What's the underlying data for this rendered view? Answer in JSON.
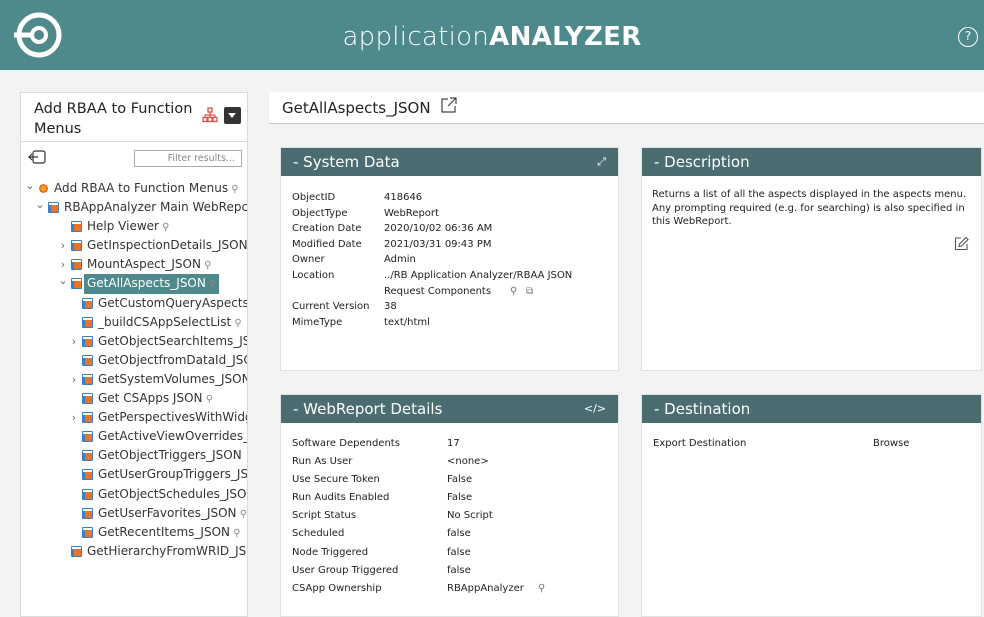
{
  "app": {
    "title_light": "application",
    "title_bold": "ANALYZER",
    "help_icon": "help-icon",
    "help_glyph": "?"
  },
  "left_panel": {
    "title": "Add RBAA to Function Menus",
    "filter_placeholder": "Filter results...",
    "tree": [
      {
        "label": "Add RBAA to Function Menus",
        "level": 0,
        "chevron": "down",
        "icon": "function-menu-icon",
        "pin": true,
        "selected": false
      },
      {
        "label": "RBAppAnalyzer Main WebRepc",
        "level": 1,
        "chevron": "down",
        "icon": "webreport-icon",
        "pin": false,
        "selected": false
      },
      {
        "label": "Help Viewer",
        "level": 2,
        "chevron": "",
        "icon": "webreport-icon",
        "pin": true,
        "selected": false
      },
      {
        "label": "GetInspectionDetails_JSON",
        "level": 2,
        "chevron": "right",
        "icon": "webreport-icon",
        "pin": false,
        "selected": false
      },
      {
        "label": "MountAspect_JSON",
        "level": 2,
        "chevron": "right",
        "icon": "webreport-icon",
        "pin": true,
        "selected": false
      },
      {
        "label": "GetAllAspects_JSON",
        "level": 2,
        "chevron": "down",
        "icon": "webreport-icon",
        "pin": true,
        "selected": true
      },
      {
        "label": "GetCustomQueryAspects_",
        "level": 3,
        "chevron": "",
        "icon": "webreport-icon",
        "pin": false,
        "selected": false
      },
      {
        "label": "_buildCSAppSelectList",
        "level": 3,
        "chevron": "",
        "icon": "webreport-icon",
        "pin": true,
        "selected": false
      },
      {
        "label": "GetObjectSearchItems_JS",
        "level": 3,
        "chevron": "right",
        "icon": "webreport-icon",
        "pin": false,
        "selected": false
      },
      {
        "label": "GetObjectfromDataId_JSC",
        "level": 3,
        "chevron": "",
        "icon": "webreport-icon",
        "pin": false,
        "selected": false
      },
      {
        "label": "GetSystemVolumes_JSON",
        "level": 3,
        "chevron": "right",
        "icon": "webreport-icon",
        "pin": false,
        "selected": false
      },
      {
        "label": "Get CSApps JSON",
        "level": 3,
        "chevron": "",
        "icon": "webreport-icon",
        "pin": true,
        "selected": false
      },
      {
        "label": "GetPerspectivesWithWidge",
        "level": 3,
        "chevron": "right",
        "icon": "webreport-icon",
        "pin": false,
        "selected": false
      },
      {
        "label": "GetActiveViewOverrides_J:",
        "level": 3,
        "chevron": "",
        "icon": "webreport-icon",
        "pin": false,
        "selected": false
      },
      {
        "label": "GetObjectTriggers_JSON",
        "level": 3,
        "chevron": "",
        "icon": "webreport-icon",
        "pin": false,
        "selected": false
      },
      {
        "label": "GetUserGroupTriggers_JSC",
        "level": 3,
        "chevron": "",
        "icon": "webreport-icon",
        "pin": false,
        "selected": false
      },
      {
        "label": "GetObjectSchedules_JSON",
        "level": 3,
        "chevron": "",
        "icon": "webreport-icon",
        "pin": false,
        "selected": false
      },
      {
        "label": "GetUserFavorites_JSON",
        "level": 3,
        "chevron": "",
        "icon": "webreport-icon",
        "pin": true,
        "selected": false
      },
      {
        "label": "GetRecentItems_JSON",
        "level": 3,
        "chevron": "",
        "icon": "webreport-icon",
        "pin": true,
        "selected": false
      },
      {
        "label": "GetHierarchyFromWRID_JSO",
        "level": 2,
        "chevron": "",
        "icon": "webreport-icon",
        "pin": false,
        "selected": false
      }
    ]
  },
  "main": {
    "title": "GetAllAspects_JSON",
    "system_data": {
      "heading": "- System Data",
      "rows": [
        {
          "key": "ObjectID",
          "value": "418646"
        },
        {
          "key": "ObjectType",
          "value": "WebReport"
        },
        {
          "key": "Creation Date",
          "value": "2020/10/02 06:36 AM"
        },
        {
          "key": "Modified Date",
          "value": "2021/03/31 09:43 PM"
        },
        {
          "key": "Owner",
          "value": "Admin"
        },
        {
          "key": "Location",
          "value": "../RB Application Analyzer/RBAA JSON"
        },
        {
          "key": "",
          "value": "Request Components"
        },
        {
          "key": "Current Version",
          "value": "38"
        },
        {
          "key": "MimeType",
          "value": "text/html"
        }
      ]
    },
    "description": {
      "heading": "- Description",
      "text": "Returns a list of all the aspects displayed in the aspects menu. Any prompting required (e.g. for searching) is also specified in this WebReport."
    },
    "webreport_details": {
      "heading": "- WebReport Details",
      "rows": [
        {
          "key": "Software Dependents",
          "value": "17"
        },
        {
          "key": "Run As User",
          "value": "<none>"
        },
        {
          "key": "Use Secure Token",
          "value": "False"
        },
        {
          "key": "Run Audits Enabled",
          "value": "False"
        },
        {
          "key": "Script Status",
          "value": "No Script"
        },
        {
          "key": "Scheduled",
          "value": "false"
        },
        {
          "key": "Node Triggered",
          "value": "false"
        },
        {
          "key": "User Group Triggered",
          "value": "false"
        },
        {
          "key": "CSApp Ownership",
          "value": "RBAppAnalyzer"
        }
      ]
    },
    "destination": {
      "heading": "- Destination",
      "rows": [
        {
          "key": "Export Destination",
          "value": "Browse"
        }
      ]
    }
  },
  "colors": {
    "header_bg": "#4e8a8c",
    "panel_head_bg": "#4b6d71",
    "selected_bg": "#4e8a8c"
  }
}
